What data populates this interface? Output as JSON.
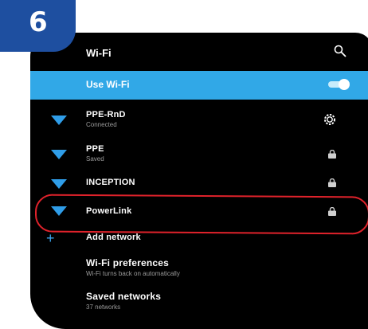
{
  "step_badge": "6",
  "header": {
    "title": "Wi-Fi",
    "search_icon": "search-icon"
  },
  "use_wifi": {
    "label": "Use Wi-Fi",
    "enabled": true
  },
  "networks": [
    {
      "name": "PPE-RnD",
      "status": "Connected",
      "trailing_icon": "gear-icon"
    },
    {
      "name": "PPE",
      "status": "Saved",
      "trailing_icon": "lock-icon"
    },
    {
      "name": "INCEPTION",
      "status": "",
      "trailing_icon": "lock-icon"
    },
    {
      "name": "PowerLink",
      "status": "",
      "trailing_icon": "lock-icon",
      "highlighted": true
    }
  ],
  "add_network": {
    "label": "Add network"
  },
  "preferences": {
    "title": "Wi-Fi preferences",
    "subtitle": "Wi-Fi turns back on automatically"
  },
  "saved_networks": {
    "title": "Saved networks",
    "subtitle": "37 networks"
  },
  "colors": {
    "accent": "#31a8e7",
    "wifi_icon": "#2f9de8",
    "highlight": "#e0222b",
    "badge": "#1e4fa0"
  }
}
